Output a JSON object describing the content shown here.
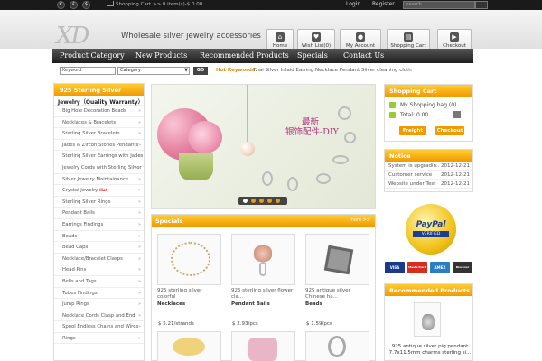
{
  "topbar": {
    "currencies": [
      "€",
      "£",
      "$"
    ],
    "cart_summary": "Shopping Cart >> 0 item(s)-$ 0.00",
    "login": "Login",
    "register": "Register",
    "search_placeholder": "search"
  },
  "header": {
    "logo": "XD",
    "tagline": "Wholesale silver jewelry accessories",
    "buttons": [
      {
        "label": "Home",
        "icon": "home-icon"
      },
      {
        "label": "Wish List(0)",
        "icon": "heart-icon"
      },
      {
        "label": "My Account",
        "icon": "user-icon"
      },
      {
        "label": "Shopping Cart",
        "icon": "cart-icon"
      },
      {
        "label": "Checkout",
        "icon": "checkout-icon"
      }
    ]
  },
  "nav": {
    "items": [
      "Product Category",
      "New Products",
      "Recommended Products",
      "Specials",
      "Contact Us"
    ]
  },
  "search": {
    "keyword_placeholder": "Keyword",
    "category": "Category",
    "go": "GO",
    "hot_label": "Hot Keywords:",
    "hot_text": "Thai Silver Inlaid Earring Necklace Pendant Silver cleaning cloth"
  },
  "left_sidebar": {
    "title": "925 Sterling Silver",
    "highlight": "Jewelry（Quality Warranty）",
    "items": [
      "Big Hole Decoration Beads",
      "Necklaces & Bracelets",
      "Sterling Silver Bracelets",
      "Jades & Zircon Stones Pendants",
      "Sterling Silver Earrings with Jades",
      "Jewelry Cords with Sterling Silver",
      "Silver Jewelry Maintainance",
      "Crystal Jewelry",
      "Sterling Silver Rings",
      "Pendant Bails",
      "Earrings Findings",
      "Beads",
      "Bead Caps",
      "Necklace/Bracelet Clasps",
      "Head Pins",
      "Bells and Tags",
      "Tubes Findings",
      "Jump Rings",
      "Necklace Cords Clasp and End",
      "Spool Endless Chains and Wires",
      "Rings"
    ],
    "hot_badge": "Hot"
  },
  "banner": {
    "cn_line1": "最新",
    "cn_line2": "银饰配件-DIY"
  },
  "specials": {
    "title": "Specials",
    "more": "more >>",
    "products": [
      {
        "name": "925 sterling silver colorful",
        "category": "Necklaces",
        "price": "$ 5.21/strands"
      },
      {
        "name": "925 sterling silver flower cla...",
        "category": "Pendant Bails",
        "price": "$ 2.93/pcs"
      },
      {
        "name": "925 antique silver Chinese ha...",
        "category": "Beads",
        "price": "$ 1.59/pcs"
      }
    ]
  },
  "cart_box": {
    "title": "Shopping Cart",
    "bag": "My Shopping bag (0)",
    "total": "Total: 0.00",
    "freight": "Freight",
    "checkout": "Checkout"
  },
  "notice": {
    "title": "Notice",
    "rows": [
      {
        "text": "System is upgradin...",
        "date": "2012-12-21"
      },
      {
        "text": "Customer service",
        "date": "2012-12-21"
      },
      {
        "text": "Website under Test",
        "date": "2012-12-21"
      }
    ]
  },
  "paypal": {
    "brand": "PayPal",
    "verified": "VERIFIED"
  },
  "cards": [
    "VISA",
    "MasterCard",
    "AMEX",
    "Discover"
  ],
  "recommended": {
    "title": "Recommended Products",
    "product_name": "925 antique silver pig pendant 7.7x11.5mm charms sterling si..."
  }
}
